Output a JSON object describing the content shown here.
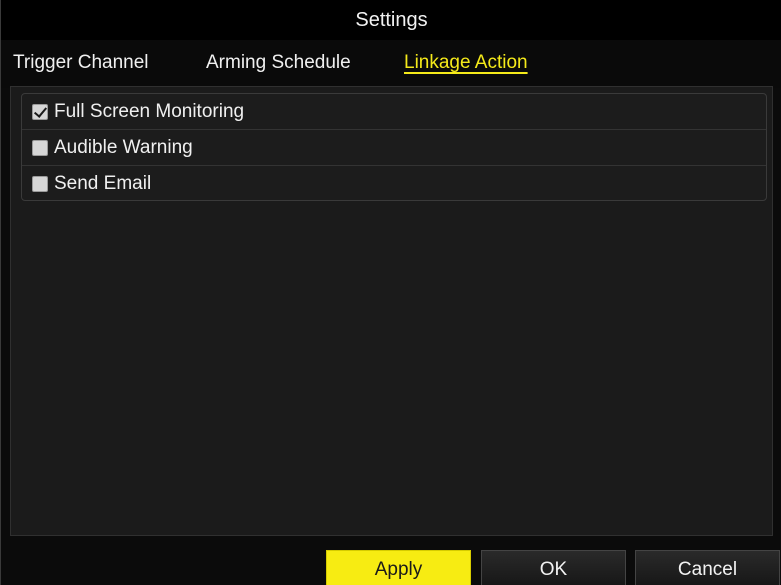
{
  "window": {
    "title": "Settings"
  },
  "tabs": [
    {
      "label": "Trigger Channel",
      "active": false
    },
    {
      "label": "Arming Schedule",
      "active": false
    },
    {
      "label": "Linkage Action",
      "active": true
    }
  ],
  "options": [
    {
      "label": "Full Screen Monitoring",
      "checked": true
    },
    {
      "label": "Audible Warning",
      "checked": false
    },
    {
      "label": "Send Email",
      "checked": false
    }
  ],
  "buttons": {
    "apply": "Apply",
    "ok": "OK",
    "cancel": "Cancel"
  },
  "colors": {
    "accent": "#f5ea1a",
    "background": "#0b0b0b",
    "panel": "#1b1b1b"
  }
}
